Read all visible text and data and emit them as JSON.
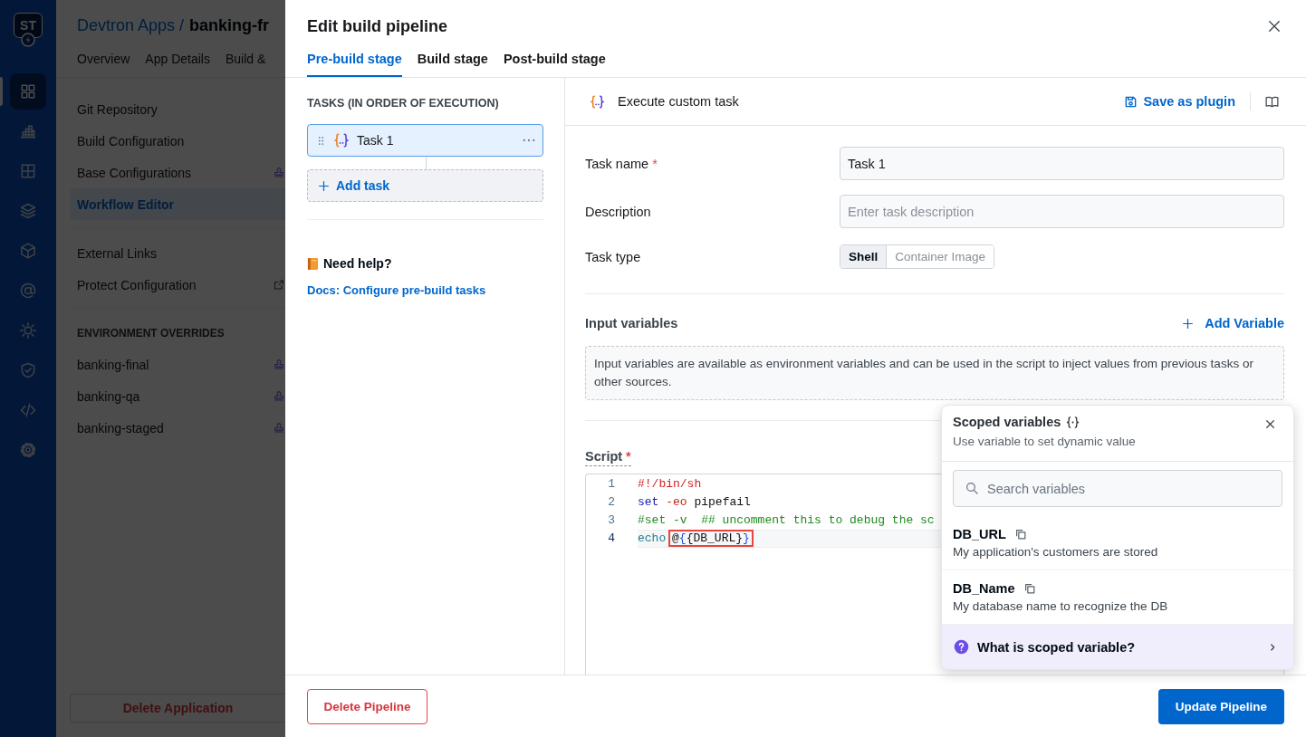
{
  "sidebar": {
    "logo": "ST",
    "nav": [
      {
        "selected": true
      },
      {
        "selected": false
      },
      {
        "selected": false
      },
      {
        "selected": false
      },
      {
        "selected": false
      },
      {
        "selected": false
      },
      {
        "selected": false
      },
      {
        "selected": false
      },
      {
        "selected": false
      },
      {
        "selected": false
      }
    ]
  },
  "app_page": {
    "breadcrumb": {
      "parent": "Devtron Apps",
      "separator": "/",
      "current": "banking-fr"
    },
    "tabs": [
      {
        "label": "Overview"
      },
      {
        "label": "App Details"
      },
      {
        "label": "Build &"
      }
    ],
    "menu_groups": [
      {
        "items": [
          {
            "label": "Git Repository",
            "kind": "plain",
            "selected": false
          },
          {
            "label": "Build Configuration",
            "kind": "plain",
            "selected": false
          },
          {
            "label": "Base Configurations",
            "kind": "stamped",
            "selected": false
          },
          {
            "label": "Workflow Editor",
            "kind": "plain",
            "selected": true
          }
        ]
      },
      {
        "items": [
          {
            "label": "External Links",
            "kind": "plain",
            "selected": false
          },
          {
            "label": "Protect Configuration",
            "kind": "linked",
            "selected": false
          }
        ]
      },
      {
        "heading": "ENVIRONMENT OVERRIDES",
        "items": [
          {
            "label": "banking-final",
            "kind": "stamped",
            "selected": false
          },
          {
            "label": "banking-qa",
            "kind": "stamped",
            "selected": false
          },
          {
            "label": "banking-staged",
            "kind": "stamped",
            "selected": false
          }
        ]
      }
    ],
    "delete_button": "Delete Application"
  },
  "modal": {
    "title": "Edit build pipeline",
    "stages": [
      {
        "label": "Pre-build stage",
        "selected": true
      },
      {
        "label": "Build stage",
        "selected": false
      },
      {
        "label": "Post-build stage",
        "selected": false
      }
    ],
    "tasks_panel": {
      "heading": "TASKS (IN ORDER OF EXECUTION)",
      "tasks": [
        {
          "name": "Task 1",
          "selected": true
        }
      ],
      "add_button": "Add task",
      "help_title": "Need help?",
      "help_link": "Docs: Configure pre-build tasks"
    },
    "task_editor": {
      "title": "Execute custom task",
      "save_button": "Save as plugin",
      "fields": [
        {
          "kind": "text",
          "label": "Task name",
          "required_mark": "*",
          "value": "Task 1"
        },
        {
          "kind": "text",
          "label": "Description",
          "placeholder": "Enter task description"
        },
        {
          "kind": "segmented",
          "label": "Task type",
          "options": [
            {
              "label": "Shell",
              "selected": true
            },
            {
              "label": "Container Image",
              "selected": false
            }
          ]
        }
      ],
      "input_variables": {
        "title": "Input variables",
        "add_button": "Add Variable",
        "note": "Input variables are available as environment variables and can be used in the script to inject values from previous tasks or other sources."
      },
      "script": {
        "label": "Script",
        "required_mark": "*",
        "lines": [
          {
            "number": "1",
            "active": false,
            "tokens": [
              {
                "text": "#!/bin/sh",
                "kind": "shebang",
                "boxed": false
              }
            ]
          },
          {
            "number": "2",
            "active": false,
            "tokens": [
              {
                "text": "set",
                "kind": "keyword",
                "boxed": false
              },
              {
                "text": " -eo",
                "kind": "option",
                "boxed": false
              },
              {
                "text": " pipefail",
                "kind": "plain",
                "boxed": false
              }
            ]
          },
          {
            "number": "3",
            "active": false,
            "tokens": [
              {
                "text": "#set -v  ## uncomment this to debug the sc",
                "kind": "comment",
                "boxed": false
              }
            ]
          },
          {
            "number": "4",
            "active": true,
            "tokens": [
              {
                "text": "echo ",
                "kind": "builtin",
                "boxed": false
              },
              {
                "text": "@",
                "kind": "plain",
                "boxed": true
              },
              {
                "text": "{",
                "kind": "brace",
                "boxed": true
              },
              {
                "text": "{DB_URL}",
                "kind": "plain",
                "boxed": true
              },
              {
                "text": "}",
                "kind": "brace",
                "boxed": true
              }
            ]
          }
        ]
      }
    },
    "footer": {
      "delete_button": "Delete Pipeline",
      "update_button": "Update Pipeline"
    },
    "scoped_variables": {
      "title": "Scoped variables",
      "subtitle": "Use variable to set dynamic value",
      "search": {
        "placeholder": "Search variables"
      },
      "variables": [
        {
          "name": "DB_URL",
          "description": "My application's customers are stored"
        },
        {
          "name": "DB_Name",
          "description": "My database name to recognize the DB"
        }
      ],
      "help_link": "What is scoped variable?"
    }
  }
}
